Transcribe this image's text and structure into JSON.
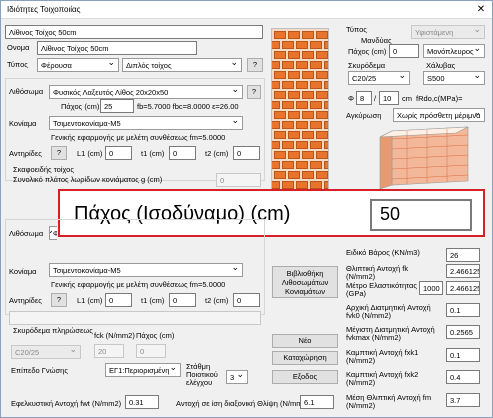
{
  "window": {
    "title": "Ιδιότητες Τοιχοποιίας",
    "close_glyph": "✕"
  },
  "header": {
    "name_value": "Λίθινος Τοίχος 50cm",
    "name_label": "Ονομα",
    "name_input": "Λίθινος Τοίχος 50cm",
    "type_label": "Τύπος",
    "type_value": "Φέρουσα",
    "subtype_value": "Διπλός τοίχος",
    "help": "?"
  },
  "masonry1": {
    "lithosoma_label": "Λιθόσωμα",
    "lithosoma_value": "Φυσικός Λαξευτός Λίθος 20x20x50",
    "thickness_label": "Πάχος (cm)",
    "thickness_value": "25",
    "props_text": "fb=5.7000 fbc=8.0000 ε=26.00",
    "mortar_label": "Κονίαμα",
    "mortar_value": "Τσιμεντοκονίαμα-M5",
    "general_text": "Γενικής εφαρμογής με μελέτη συνθέσεως fm=5.0000",
    "antirides_label": "Αντηρίδες",
    "L1_label": "L1 (cm)",
    "L1_value": "0",
    "t1_label": "t1 (cm)",
    "t1_value": "0",
    "t2_label": "t2 (cm)",
    "t2_value": "0",
    "help": "?"
  },
  "joints": {
    "title": "Σκαφοειδής τοίχος",
    "text": "Συνολικό πλάτος λωρίδων κονιάματος g (cm)",
    "value": "0"
  },
  "masonry2": {
    "lithosoma_label": "Λιθόσωμα",
    "lithosoma_value": "Φυ",
    "mortar_label": "Κονίαμα",
    "mortar_value": "Τσιμεντοκονίαμα-M5",
    "general_text": "Γενικής εφαρμογής με μελέτη συνθέσεως fm=5.0000",
    "antirides_label": "Αντηρίδες",
    "L1_label": "L1 (cm)",
    "L1_value": "0",
    "t1_label": "t1 (cm)",
    "t1_value": "0",
    "t2_label": "t2 (cm)",
    "t2_value": "0",
    "help": "?"
  },
  "fill_concrete": {
    "title": "Σκυρόδεμα πληρώσεως",
    "class_value": "C20/25",
    "fck_label": "fck (N/mm2)",
    "fck_value": "20",
    "thick_label": "Πάχος (cm)",
    "thick_value": "0"
  },
  "knowledge": {
    "label": "Επίπεδο Γνώσης",
    "value": "ΕΓ1:Περιορισμένη",
    "control_label": "Στάθμη Ποιοτικού ελέγχου",
    "control_value": "3"
  },
  "bottom": {
    "flex_label": "Εφελκυστική Αντοχή fwt (N/mm2)",
    "flex_value": "0.31",
    "comp_label": "Αντοχή σε ίση διαξονική Θλίψη (N/mm2)",
    "comp_value": "6.1"
  },
  "right_panel": {
    "type_label": "Τύπος",
    "type_value": "Υφιστάμενη",
    "mandyas_label": "Μανδύας",
    "thick_label": "Πάχος (cm)",
    "thick_value": "0",
    "side_value": "Μονόπλευρος",
    "concrete_label": "Σκυρόδεμα",
    "steel_label": "Χάλυβας",
    "concrete_value": "C20/25",
    "steel_value": "S500",
    "phi_label": "Φ",
    "phi_value": "8",
    "slash": "/",
    "spacing_value": "10",
    "cm_label": "cm",
    "frd_label": "fRdo,c(MPa)=",
    "anchor_label": "Αγκύρωση",
    "anchor_value": "Χωρίς πρόσθετη μέριμνα"
  },
  "zoom": {
    "label": "Πάχος (Ισοδύναμο) (cm)",
    "value": "50"
  },
  "library_button": "Βιβλιοθήκη Λιθοσωμάτων Κονιαμάτων",
  "actions": {
    "new": "Νέο",
    "save": "Καταχώρηση",
    "exit": "Εξοδος"
  },
  "properties": [
    {
      "label": "Ειδικό Βάρος (KN/m3)",
      "value": "26"
    },
    {
      "label": "Θλιπτική Αντοχή fk (N/mm2)",
      "value": "2.466125"
    },
    {
      "label": "Μέτρο Ελαστικότητας (GPa)",
      "value": "2.466125",
      "extra": "1000"
    },
    {
      "label": "Αρχική Διατμητική Αντοχή fvk0 (N/mm2)",
      "value": "0.1"
    },
    {
      "label": "Μέγιστη Διατμητική Αντοχή fvkmax (N/mm2)",
      "value": "0.2565"
    },
    {
      "label": "Καμπτική Αντοχή fxk1 (N/mm2)",
      "value": "0.1"
    },
    {
      "label": "Καμπτική Αντοχή fxk2 (N/mm2)",
      "value": "0.4"
    },
    {
      "label": "Μέση Θλιπτική Αντοχή fm (N/mm2)",
      "value": "3.7"
    }
  ]
}
